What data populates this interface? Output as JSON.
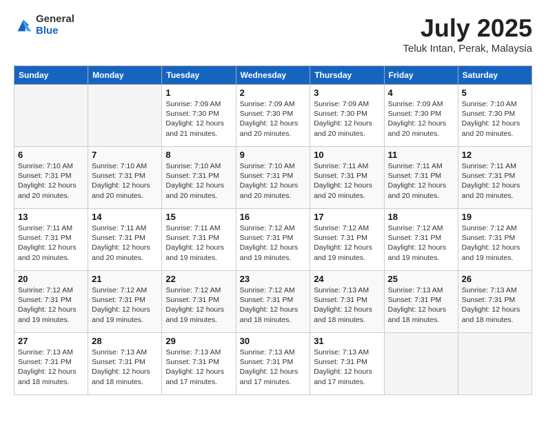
{
  "header": {
    "logo_line1": "General",
    "logo_line2": "Blue",
    "month": "July 2025",
    "location": "Teluk Intan, Perak, Malaysia"
  },
  "weekdays": [
    "Sunday",
    "Monday",
    "Tuesday",
    "Wednesday",
    "Thursday",
    "Friday",
    "Saturday"
  ],
  "weeks": [
    [
      {
        "day": "",
        "info": ""
      },
      {
        "day": "",
        "info": ""
      },
      {
        "day": "1",
        "info": "Sunrise: 7:09 AM\nSunset: 7:30 PM\nDaylight: 12 hours\nand 21 minutes."
      },
      {
        "day": "2",
        "info": "Sunrise: 7:09 AM\nSunset: 7:30 PM\nDaylight: 12 hours\nand 20 minutes."
      },
      {
        "day": "3",
        "info": "Sunrise: 7:09 AM\nSunset: 7:30 PM\nDaylight: 12 hours\nand 20 minutes."
      },
      {
        "day": "4",
        "info": "Sunrise: 7:09 AM\nSunset: 7:30 PM\nDaylight: 12 hours\nand 20 minutes."
      },
      {
        "day": "5",
        "info": "Sunrise: 7:10 AM\nSunset: 7:30 PM\nDaylight: 12 hours\nand 20 minutes."
      }
    ],
    [
      {
        "day": "6",
        "info": "Sunrise: 7:10 AM\nSunset: 7:31 PM\nDaylight: 12 hours\nand 20 minutes."
      },
      {
        "day": "7",
        "info": "Sunrise: 7:10 AM\nSunset: 7:31 PM\nDaylight: 12 hours\nand 20 minutes."
      },
      {
        "day": "8",
        "info": "Sunrise: 7:10 AM\nSunset: 7:31 PM\nDaylight: 12 hours\nand 20 minutes."
      },
      {
        "day": "9",
        "info": "Sunrise: 7:10 AM\nSunset: 7:31 PM\nDaylight: 12 hours\nand 20 minutes."
      },
      {
        "day": "10",
        "info": "Sunrise: 7:11 AM\nSunset: 7:31 PM\nDaylight: 12 hours\nand 20 minutes."
      },
      {
        "day": "11",
        "info": "Sunrise: 7:11 AM\nSunset: 7:31 PM\nDaylight: 12 hours\nand 20 minutes."
      },
      {
        "day": "12",
        "info": "Sunrise: 7:11 AM\nSunset: 7:31 PM\nDaylight: 12 hours\nand 20 minutes."
      }
    ],
    [
      {
        "day": "13",
        "info": "Sunrise: 7:11 AM\nSunset: 7:31 PM\nDaylight: 12 hours\nand 20 minutes."
      },
      {
        "day": "14",
        "info": "Sunrise: 7:11 AM\nSunset: 7:31 PM\nDaylight: 12 hours\nand 20 minutes."
      },
      {
        "day": "15",
        "info": "Sunrise: 7:11 AM\nSunset: 7:31 PM\nDaylight: 12 hours\nand 19 minutes."
      },
      {
        "day": "16",
        "info": "Sunrise: 7:12 AM\nSunset: 7:31 PM\nDaylight: 12 hours\nand 19 minutes."
      },
      {
        "day": "17",
        "info": "Sunrise: 7:12 AM\nSunset: 7:31 PM\nDaylight: 12 hours\nand 19 minutes."
      },
      {
        "day": "18",
        "info": "Sunrise: 7:12 AM\nSunset: 7:31 PM\nDaylight: 12 hours\nand 19 minutes."
      },
      {
        "day": "19",
        "info": "Sunrise: 7:12 AM\nSunset: 7:31 PM\nDaylight: 12 hours\nand 19 minutes."
      }
    ],
    [
      {
        "day": "20",
        "info": "Sunrise: 7:12 AM\nSunset: 7:31 PM\nDaylight: 12 hours\nand 19 minutes."
      },
      {
        "day": "21",
        "info": "Sunrise: 7:12 AM\nSunset: 7:31 PM\nDaylight: 12 hours\nand 19 minutes."
      },
      {
        "day": "22",
        "info": "Sunrise: 7:12 AM\nSunset: 7:31 PM\nDaylight: 12 hours\nand 19 minutes."
      },
      {
        "day": "23",
        "info": "Sunrise: 7:12 AM\nSunset: 7:31 PM\nDaylight: 12 hours\nand 18 minutes."
      },
      {
        "day": "24",
        "info": "Sunrise: 7:13 AM\nSunset: 7:31 PM\nDaylight: 12 hours\nand 18 minutes."
      },
      {
        "day": "25",
        "info": "Sunrise: 7:13 AM\nSunset: 7:31 PM\nDaylight: 12 hours\nand 18 minutes."
      },
      {
        "day": "26",
        "info": "Sunrise: 7:13 AM\nSunset: 7:31 PM\nDaylight: 12 hours\nand 18 minutes."
      }
    ],
    [
      {
        "day": "27",
        "info": "Sunrise: 7:13 AM\nSunset: 7:31 PM\nDaylight: 12 hours\nand 18 minutes."
      },
      {
        "day": "28",
        "info": "Sunrise: 7:13 AM\nSunset: 7:31 PM\nDaylight: 12 hours\nand 18 minutes."
      },
      {
        "day": "29",
        "info": "Sunrise: 7:13 AM\nSunset: 7:31 PM\nDaylight: 12 hours\nand 17 minutes."
      },
      {
        "day": "30",
        "info": "Sunrise: 7:13 AM\nSunset: 7:31 PM\nDaylight: 12 hours\nand 17 minutes."
      },
      {
        "day": "31",
        "info": "Sunrise: 7:13 AM\nSunset: 7:31 PM\nDaylight: 12 hours\nand 17 minutes."
      },
      {
        "day": "",
        "info": ""
      },
      {
        "day": "",
        "info": ""
      }
    ]
  ]
}
